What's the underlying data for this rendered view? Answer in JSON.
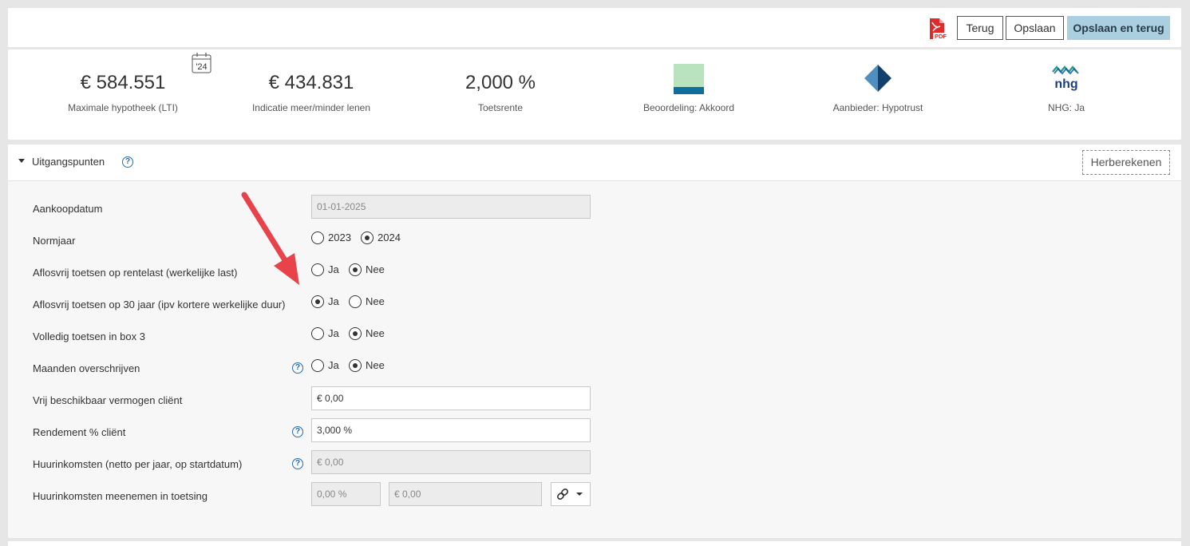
{
  "toolbar": {
    "pdf_icon": "pdf-file-icon",
    "pdf_icon_text": "PDF",
    "back_label": "Terug",
    "save_label": "Opslaan",
    "save_back_label": "Opslaan en terug"
  },
  "summary": {
    "max_mortgage": {
      "value": "€ 584.551",
      "label": "Maximale hypotheek (LTI)",
      "calendar_badge": "'24"
    },
    "indication": {
      "value": "€ 434.831",
      "label": "Indicatie meer/minder lenen"
    },
    "test_rate": {
      "value": "2,000 %",
      "label": "Toetsrente"
    },
    "assessment": {
      "label": "Beoordeling: Akkoord",
      "colors": [
        "#b9e2bf",
        "#0e6f9c"
      ]
    },
    "provider": {
      "label": "Aanbieder: Hypotrust",
      "colors": [
        "#123f6b",
        "#4f8fc0"
      ]
    },
    "nhg": {
      "label": "NHG: Ja",
      "logo_text": "nhg"
    }
  },
  "section": {
    "title": "Uitgangspunten",
    "recalc_label": "Herberekenen"
  },
  "form": {
    "purchase_date": {
      "label": "Aankoopdatum",
      "value": "01-01-2025"
    },
    "norm_year": {
      "label": "Normjaar",
      "options": [
        "2023",
        "2024"
      ],
      "selected": "2024"
    },
    "interest_only_actual": {
      "label": "Aflosvrij toetsen op rentelast (werkelijke last)",
      "options": [
        "Ja",
        "Nee"
      ],
      "selected": "Nee"
    },
    "interest_only_30": {
      "label": "Aflosvrij toetsen op 30 jaar (ipv kortere werkelijke duur)",
      "options": [
        "Ja",
        "Nee"
      ],
      "selected": "Ja"
    },
    "box3": {
      "label": "Volledig toetsen in box 3",
      "options": [
        "Ja",
        "Nee"
      ],
      "selected": "Nee"
    },
    "override_months": {
      "label": "Maanden overschrijven",
      "options": [
        "Ja",
        "Nee"
      ],
      "selected": "Nee"
    },
    "free_assets": {
      "label": "Vrij beschikbaar vermogen cliënt",
      "value": "€ 0,00"
    },
    "return_pct": {
      "label": "Rendement % cliënt",
      "value": "3,000 %"
    },
    "rental_income": {
      "label": "Huurinkomsten (netto per jaar, op startdatum)",
      "value": "€ 0,00"
    },
    "rental_in_test": {
      "label": "Huurinkomsten meenemen in toetsing",
      "pct": "0,00 %",
      "amount": "€ 0,00"
    }
  },
  "colors": {
    "accent_button": "#a9cfe0",
    "help_blue": "#2b6cb0",
    "annotation_arrow": "#e8434a"
  }
}
